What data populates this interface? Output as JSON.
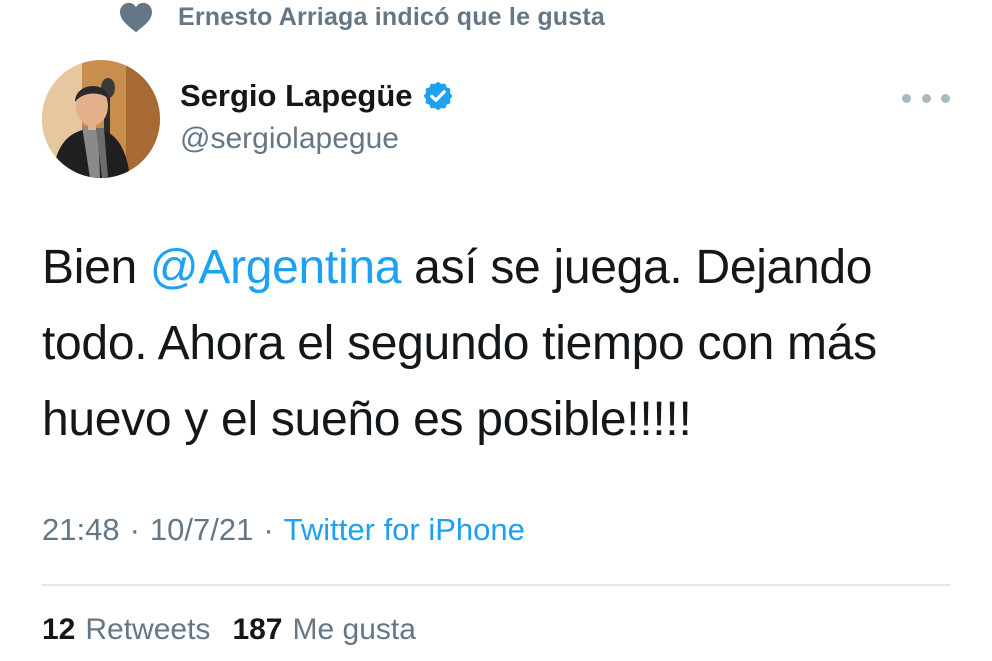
{
  "social_context": {
    "icon": "heart-icon",
    "text": "Ernesto Arriaga indicó que le gusta"
  },
  "author": {
    "display_name": "Sergio Lapegüe",
    "handle": "@sergiolapegue",
    "verified": true,
    "verified_icon": "verified-badge-icon",
    "avatar_icon": "avatar-photo"
  },
  "more_button": {
    "icon": "more-dots-icon"
  },
  "tweet": {
    "text_before": "Bien ",
    "mention": "@Argentina",
    "text_after": " así se juega. Dejando todo. Ahora el segundo tiempo con más huevo y el sueño es posible!!!!!"
  },
  "meta": {
    "time": "21:48",
    "separator": "·",
    "date": "10/7/21",
    "source": "Twitter for iPhone"
  },
  "stats": {
    "retweets_count": "12",
    "retweets_label": "Retweets",
    "likes_count": "187",
    "likes_label": "Me gusta"
  },
  "colors": {
    "accent": "#1da1f2",
    "secondary_text": "#657786",
    "primary_text": "#14171a",
    "divider": "#e1e8ed"
  }
}
